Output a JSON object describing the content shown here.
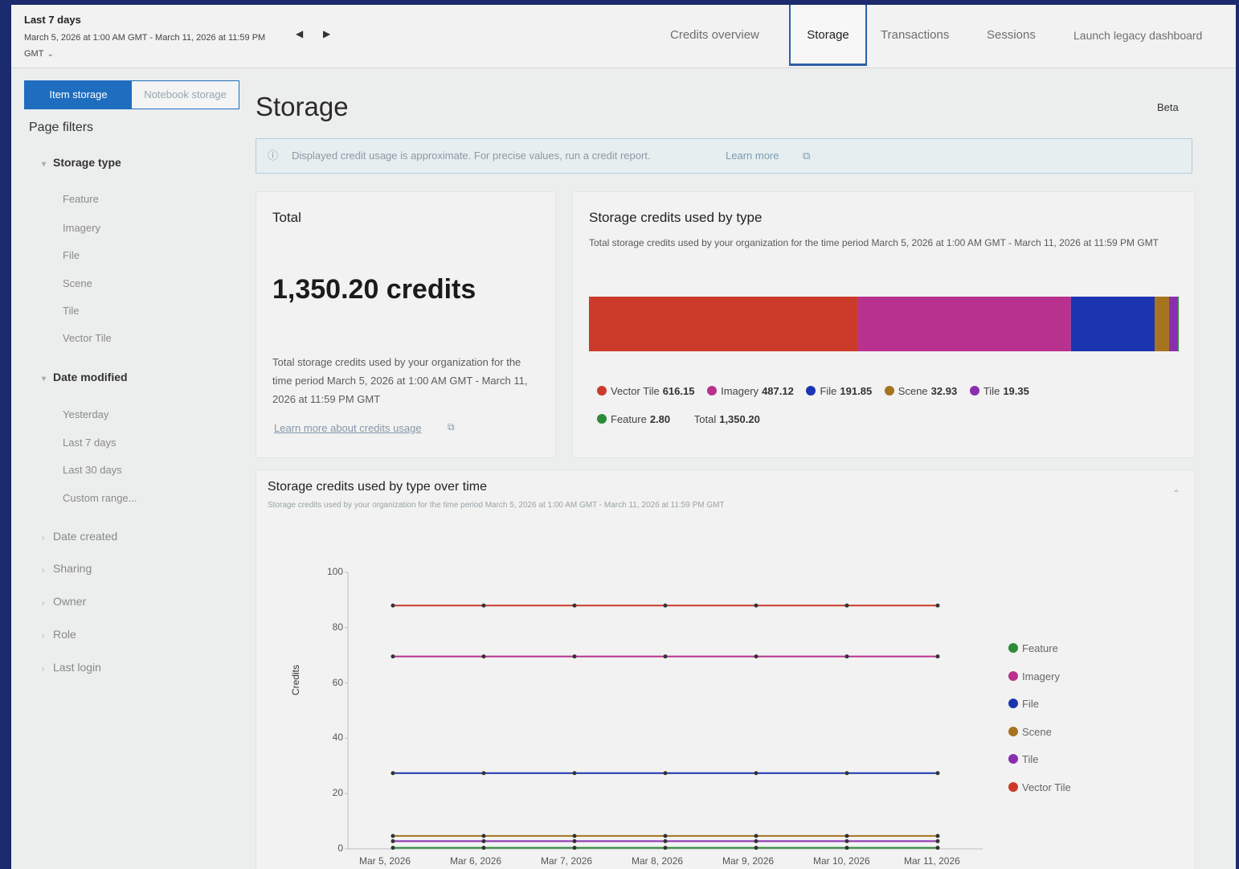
{
  "header": {
    "range_title": "Last 7 days",
    "range_dates": "March 5, 2026 at 1:00 AM GMT - March 11, 2026 at 11:59 PM GMT",
    "tabs": [
      {
        "label": "Credits overview"
      },
      {
        "label": "Storage"
      },
      {
        "label": "Transactions"
      },
      {
        "label": "Sessions"
      },
      {
        "label": "Launch legacy dashboard"
      }
    ],
    "active_tab": "Storage"
  },
  "sidebar": {
    "segment": {
      "item_storage": "Item storage",
      "notebook_storage": "Notebook storage"
    },
    "filters_title": "Page filters",
    "storage_type": {
      "label": "Storage type",
      "options": [
        "Feature",
        "Imagery",
        "File",
        "Scene",
        "Tile",
        "Vector Tile"
      ]
    },
    "date_modified": {
      "label": "Date modified",
      "options": [
        "Yesterday",
        "Last 7 days",
        "Last 30 days",
        "Custom range..."
      ]
    },
    "collapsed_groups": [
      "Date created",
      "Sharing",
      "Owner",
      "Role",
      "Last login"
    ]
  },
  "main": {
    "title": "Storage",
    "badge": "Beta",
    "notice": {
      "text": "Displayed credit usage is approximate. For precise values, run a credit report.",
      "link": "Learn more"
    }
  },
  "total_card": {
    "title": "Total",
    "value": "1,350.20 credits",
    "description": "Total storage credits used by your organization for the time period March 5, 2026 at 1:00 AM GMT - March 11, 2026 at 11:59 PM GMT",
    "link": "Learn more about credits usage"
  },
  "by_type_card": {
    "title": "Storage credits used by type",
    "subtitle": "Total storage credits used by your organization for the time period March 5, 2026 at 1:00 AM GMT - March 11, 2026 at 11:59 PM GMT",
    "legend": [
      {
        "name": "Vector Tile",
        "value": "616.15",
        "color": "#cc3b2a"
      },
      {
        "name": "Imagery",
        "value": "487.12",
        "color": "#b8318e"
      },
      {
        "name": "File",
        "value": "191.85",
        "color": "#1b34b0"
      },
      {
        "name": "Scene",
        "value": "32.93",
        "color": "#a6731f"
      },
      {
        "name": "Tile",
        "value": "19.35",
        "color": "#8a2eb0"
      },
      {
        "name": "Feature",
        "value": "2.80",
        "color": "#2e8a3a"
      }
    ],
    "total_label": "Total",
    "total_value": "1,350.20"
  },
  "over_time_card": {
    "title": "Storage credits used by type over time",
    "subtitle": "Storage credits used by your organization for the time period March 5, 2026 at 1:00 AM GMT - March 11, 2026 at 11:59 PM GMT"
  },
  "chart_data": [
    {
      "type": "bar",
      "title": "Storage credits used by type",
      "orientation": "horizontal-stacked",
      "categories": [
        "Vector Tile",
        "Imagery",
        "File",
        "Scene",
        "Tile",
        "Feature"
      ],
      "values": [
        616.15,
        487.12,
        191.85,
        32.93,
        19.35,
        2.8
      ],
      "colors": [
        "#cc3b2a",
        "#b8318e",
        "#1b34b0",
        "#a6731f",
        "#8a2eb0",
        "#2e8a3a"
      ],
      "total": 1350.2
    },
    {
      "type": "line",
      "title": "Storage credits used by type over time",
      "ylabel": "Credits",
      "ylim": [
        0,
        100
      ],
      "yticks": [
        0,
        20,
        40,
        60,
        80,
        100
      ],
      "x": [
        "Mar 5, 2026",
        "Mar 6, 2026",
        "Mar 7, 2026",
        "Mar 8, 2026",
        "Mar 9, 2026",
        "Mar 10, 2026",
        "Mar 11, 2026"
      ],
      "series": [
        {
          "name": "Feature",
          "color": "#2e8a3a",
          "values": [
            0.4,
            0.4,
            0.4,
            0.4,
            0.4,
            0.4,
            0.4
          ]
        },
        {
          "name": "Imagery",
          "color": "#b8318e",
          "values": [
            69.6,
            69.6,
            69.6,
            69.6,
            69.6,
            69.6,
            69.6
          ]
        },
        {
          "name": "File",
          "color": "#1b34b0",
          "values": [
            27.4,
            27.4,
            27.4,
            27.4,
            27.4,
            27.4,
            27.4
          ]
        },
        {
          "name": "Scene",
          "color": "#a6731f",
          "values": [
            4.7,
            4.7,
            4.7,
            4.7,
            4.7,
            4.7,
            4.7
          ]
        },
        {
          "name": "Tile",
          "color": "#8a2eb0",
          "values": [
            2.8,
            2.8,
            2.8,
            2.8,
            2.8,
            2.8,
            2.8
          ]
        },
        {
          "name": "Vector Tile",
          "color": "#cc3b2a",
          "values": [
            88.0,
            88.0,
            88.0,
            88.0,
            88.0,
            88.0,
            88.0
          ]
        }
      ],
      "legend": "right"
    }
  ]
}
